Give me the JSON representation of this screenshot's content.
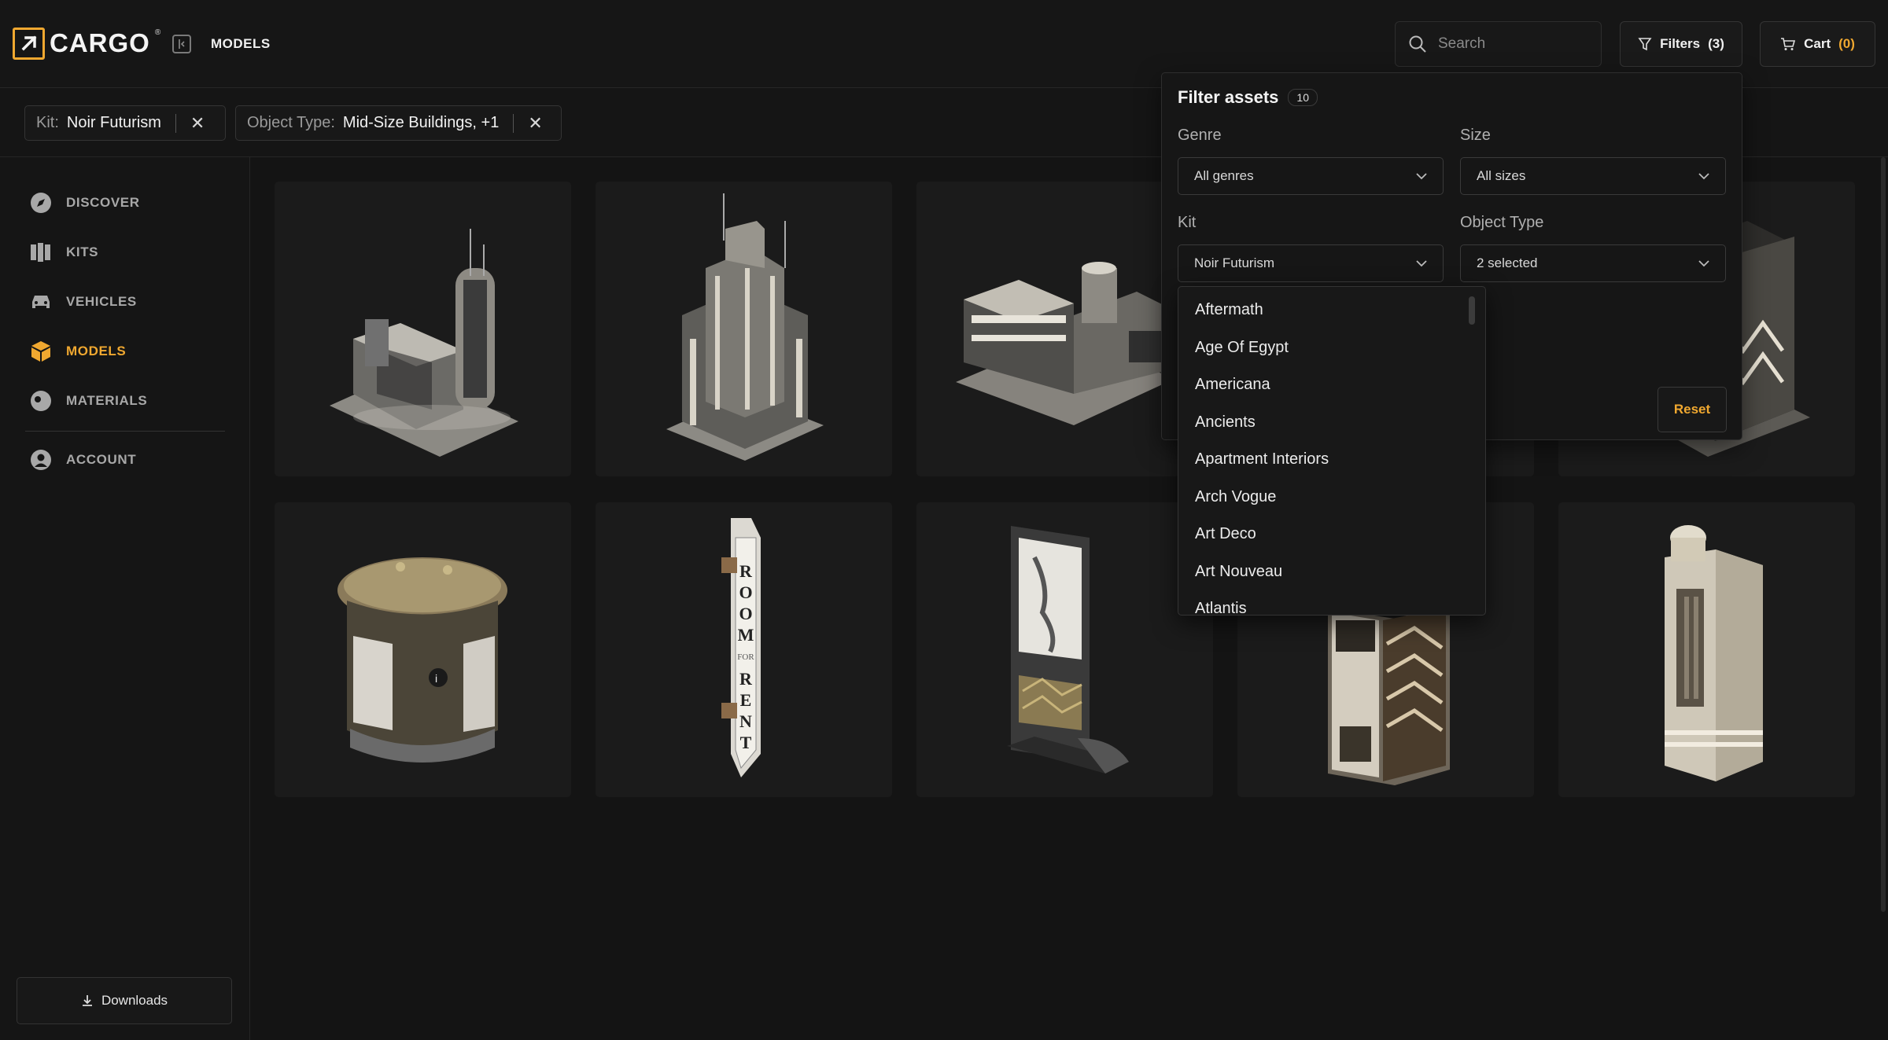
{
  "brand": {
    "name": "CARGO",
    "reg": "®"
  },
  "header": {
    "breadcrumb": "MODELS",
    "search_placeholder": "Search",
    "filters_label": "Filters",
    "filters_count": "(3)",
    "cart_label": "Cart",
    "cart_count": "(0)"
  },
  "chips": [
    {
      "key": "Kit:",
      "value": "Noir Futurism"
    },
    {
      "key": "Object Type:",
      "value": "Mid-Size Buildings, +1"
    }
  ],
  "sidebar": {
    "items": [
      {
        "label": "DISCOVER",
        "icon": "compass-icon"
      },
      {
        "label": "KITS",
        "icon": "kits-icon"
      },
      {
        "label": "VEHICLES",
        "icon": "car-icon"
      },
      {
        "label": "MODELS",
        "icon": "cube-icon",
        "active": true
      },
      {
        "label": "MATERIALS",
        "icon": "sphere-icon"
      },
      {
        "label": "ACCOUNT",
        "icon": "user-icon"
      }
    ],
    "downloads_label": "Downloads"
  },
  "filter_panel": {
    "title": "Filter assets",
    "count": "10",
    "genre_label": "Genre",
    "genre_value": "All genres",
    "size_label": "Size",
    "size_value": "All sizes",
    "kit_label": "Kit",
    "kit_value": "Noir Futurism",
    "object_type_label": "Object Type",
    "object_type_value": "2 selected",
    "reset_label": "Reset"
  },
  "kit_options": [
    "Aftermath",
    "Age Of Egypt",
    "Americana",
    "Ancients",
    "Apartment Interiors",
    "Arch Vogue",
    "Art Deco",
    "Art Nouveau",
    "Atlantis"
  ],
  "models": [
    {
      "name": "tower-complex-model"
    },
    {
      "name": "deco-skyscraper-model"
    },
    {
      "name": "low-rise-complex-model"
    },
    {
      "name": "covered-building-model"
    },
    {
      "name": "patterned-tower-model"
    },
    {
      "name": "kiosk-model"
    },
    {
      "name": "room-for-rent-sign-model"
    },
    {
      "name": "map-display-model"
    },
    {
      "name": "vending-machine-model"
    },
    {
      "name": "deco-pillar-model"
    }
  ],
  "sign_text": "ROOM FOR RENT",
  "colors": {
    "accent": "#f0a830",
    "background": "#141414",
    "panel": "#161616"
  }
}
